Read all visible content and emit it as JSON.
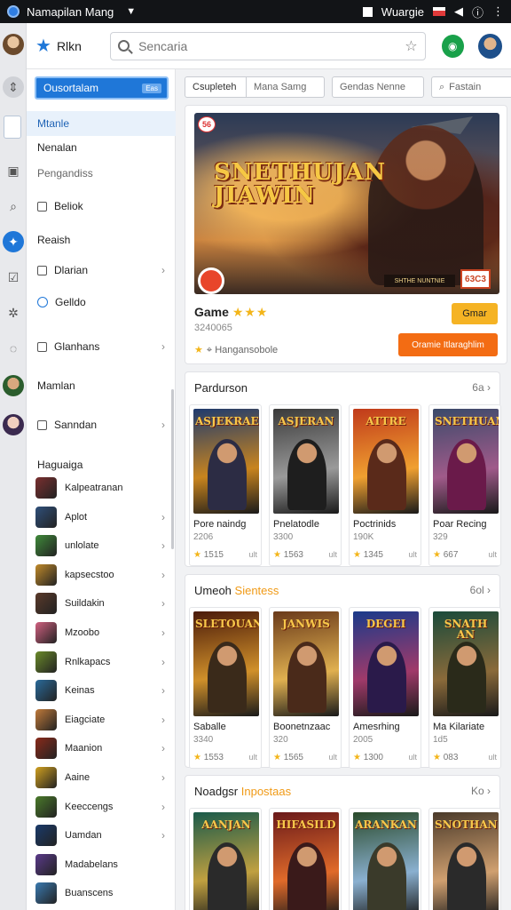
{
  "statusbar": {
    "title": "Namapilan Mang",
    "account": "Wuargie"
  },
  "topbar": {
    "brand": "Rlkn",
    "search_placeholder": "Sencaria"
  },
  "sidebar": {
    "cta": "Ousortalam",
    "cta_badge": "Eas",
    "rows": [
      {
        "label": "Mtanle",
        "state": "active"
      },
      {
        "label": "Nenalan",
        "state": "plain"
      },
      {
        "label": "Pengandiss",
        "state": "muted"
      },
      {
        "label": "Beliok",
        "state": "icon"
      },
      {
        "label": "Reaish",
        "state": "plain"
      },
      {
        "label": "Dlarian",
        "state": "icon-chev"
      },
      {
        "label": "Gelldo",
        "state": "round"
      },
      {
        "label": "Glanhans",
        "state": "icon-chev"
      },
      {
        "label": "Mamlan",
        "state": "plain"
      },
      {
        "label": "Sanndan",
        "state": "icon-chev"
      }
    ],
    "games_heading": "Haguaiga",
    "games": [
      {
        "label": "Kalpeatranan",
        "color": "#7a2f2f"
      },
      {
        "label": "Aplot",
        "color": "#2f4f7a"
      },
      {
        "label": "unlolate",
        "color": "#3f8a3a"
      },
      {
        "label": "kapsecstoo",
        "color": "#c08a2a"
      },
      {
        "label": "Suildakin",
        "color": "#5a3a2a"
      },
      {
        "label": "Mzoobo",
        "color": "#d06080"
      },
      {
        "label": "Rnlkapacs",
        "color": "#6a8a2a"
      },
      {
        "label": "Keinas",
        "color": "#2a6a9a"
      },
      {
        "label": "Eiagciate",
        "color": "#c07a3a"
      },
      {
        "label": "Maanion",
        "color": "#8a2a1a"
      },
      {
        "label": "Aaine",
        "color": "#d0a020"
      },
      {
        "label": "Keeccengs",
        "color": "#4a7a2a"
      },
      {
        "label": "Uamdan",
        "color": "#1a3a6a"
      },
      {
        "label": "Madabelans",
        "color": "#5a3a8a"
      },
      {
        "label": "Buanscens",
        "color": "#3a7ab0"
      }
    ]
  },
  "filters": [
    "Csupleteh",
    "Mana Samg",
    "Gendas Nenne",
    "Fastain"
  ],
  "hero": {
    "corner_badge": "56",
    "art_title_line1": "SNETHUJAN",
    "art_title_line2": "JIAWIN",
    "art_strip": "SHTHE NUNTNIE",
    "art_logo": "63C3",
    "name": "Game",
    "stars": "★★★",
    "sub": "3240065",
    "rating_text": "Hangansobole",
    "get_label": "Gmar",
    "action_label": "Oramie Itlaraghlim"
  },
  "sections": [
    {
      "title_plain": "Pardurson",
      "title_hl": "",
      "more": "6a",
      "cards": [
        {
          "art": "ASJEKRAE",
          "name": "Pore naindg",
          "size": "2206",
          "rating": "1515",
          "tag": "ult",
          "c1": "#1e3a6e",
          "c2": "#c8841e",
          "fig": "#2c2c44"
        },
        {
          "art": "ASJERAN",
          "name": "Pnelatodle",
          "size": "3300",
          "rating": "1563",
          "tag": "ult",
          "c1": "#3a3a3a",
          "c2": "#9a9a9a",
          "fig": "#1e1e1e"
        },
        {
          "art": "ATTRE",
          "name": "Poctrinids",
          "size": "190K",
          "rating": "1345",
          "tag": "ult",
          "c1": "#c03a1a",
          "c2": "#f0a030",
          "fig": "#5a2a1a"
        },
        {
          "art": "SNETHUAN",
          "name": "Poar Recing",
          "size": "329",
          "rating": "667",
          "tag": "ult",
          "c1": "#3a4a6a",
          "c2": "#a05a8a",
          "fig": "#6a1a4a"
        }
      ]
    },
    {
      "title_plain": "Umeoh ",
      "title_hl": "Sientess",
      "more": "6ol",
      "cards": [
        {
          "art": "SLETOUAN",
          "name": "Saballe",
          "size": "3340",
          "rating": "1553",
          "tag": "ult",
          "c1": "#4a1a0a",
          "c2": "#d0902a",
          "fig": "#3a2a1a"
        },
        {
          "art": "JANWIS",
          "name": "Boonetnzaac",
          "size": "320",
          "rating": "1565",
          "tag": "ult",
          "c1": "#6a3a1a",
          "c2": "#e0b050",
          "fig": "#4a2a1a"
        },
        {
          "art": "DEGEI",
          "name": "Amesrhing",
          "size": "2005",
          "rating": "1300",
          "tag": "ult",
          "c1": "#1a3a8a",
          "c2": "#a03a6a",
          "fig": "#2a1a4a"
        },
        {
          "art": "SNATH AN",
          "name": "Ma Kilariate",
          "size": "1d5",
          "rating": "083",
          "tag": "ult",
          "c1": "#1a4a3a",
          "c2": "#8a6a3a",
          "fig": "#2a2a1a"
        }
      ]
    },
    {
      "title_plain": "Noadgsr ",
      "title_hl": "Inpostaas",
      "more": "Ko",
      "cards": [
        {
          "art": "AANJAN",
          "name": "",
          "size": "",
          "rating": "",
          "tag": "",
          "c1": "#1a5a4a",
          "c2": "#c0a040",
          "fig": "#2a2a2a"
        },
        {
          "art": "HIFASILD",
          "name": "",
          "size": "",
          "rating": "",
          "tag": "",
          "c1": "#6a1a1a",
          "c2": "#e06a2a",
          "fig": "#3a1a1a"
        },
        {
          "art": "ARANKAN",
          "name": "",
          "size": "",
          "rating": "",
          "tag": "",
          "c1": "#2a4a2a",
          "c2": "#8ab0d0",
          "fig": "#3a3a2a"
        },
        {
          "art": "SNOTHAN",
          "name": "",
          "size": "",
          "rating": "",
          "tag": "",
          "c1": "#4a3a2a",
          "c2": "#d0a070",
          "fig": "#2a2a2a"
        }
      ]
    }
  ]
}
